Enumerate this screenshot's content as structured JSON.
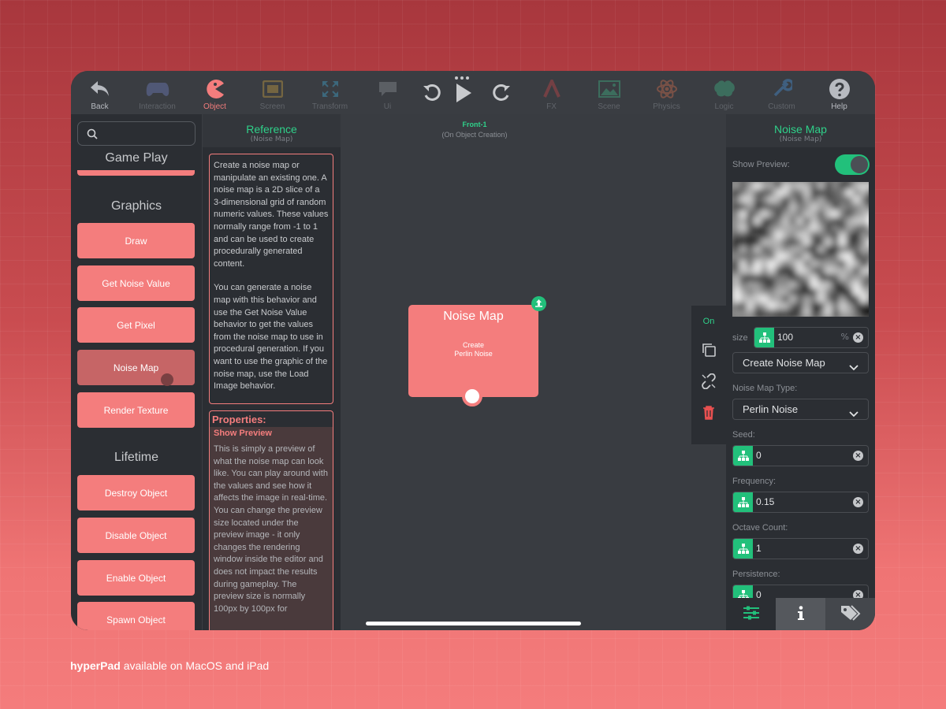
{
  "toolbar": {
    "items": [
      {
        "label": "Back",
        "icon": "back-arrow-icon",
        "state": "white"
      },
      {
        "label": "Interaction",
        "icon": "gamepad-icon",
        "state": "dim"
      },
      {
        "label": "Object",
        "icon": "pacman-icon",
        "state": "active"
      },
      {
        "label": "Screen",
        "icon": "screen-icon",
        "state": "dim"
      },
      {
        "label": "Transform",
        "icon": "expand-arrows-icon",
        "state": "dim"
      },
      {
        "label": "Ui",
        "icon": "chat-bubble-icon",
        "state": "dim"
      },
      {
        "label": "FX",
        "icon": "fx-icon",
        "state": "dim"
      },
      {
        "label": "Scene",
        "icon": "landscape-image-icon",
        "state": "dim"
      },
      {
        "label": "Physics",
        "icon": "atom-icon",
        "state": "dim"
      },
      {
        "label": "Logic",
        "icon": "brain-icon",
        "state": "dim"
      },
      {
        "label": "Custom",
        "icon": "wrench-icon",
        "state": "dim"
      },
      {
        "label": "Help",
        "icon": "question-icon",
        "state": "white"
      }
    ]
  },
  "sidebar": {
    "search_placeholder": "",
    "sections": {
      "game_play": "Game Play",
      "graphics": "Graphics",
      "lifetime": "Lifetime"
    },
    "graphics_items": [
      "Draw",
      "Get Noise Value",
      "Get Pixel",
      "Noise Map",
      "Render Texture"
    ],
    "lifetime_items": [
      "Destroy Object",
      "Disable Object",
      "Enable Object",
      "Spawn Object"
    ],
    "selected": "Noise Map"
  },
  "reference": {
    "title": "Reference",
    "subtitle": "(Noise Map)",
    "description_1": "Create a noise map or manipulate an existing one. A noise map is a 2D slice of a 3-dimensional grid of random numeric values. These values normally range from -1 to 1 and can be used to create procedurally generated content.",
    "description_2": "You can generate a noise map with this behavior and use the Get Noise Value behavior to get the values from the noise map to use in procedural generation. If you want to use the graphic of the noise map, use the Load Image behavior.",
    "properties_title": "Properties:",
    "prop_name": "Show Preview",
    "prop_desc": "This is simply a preview of what the noise map can look like. You can play around with the values and see how it affects the image in real-time. You can change the preview size located under the preview image - it only changes the rendering window inside the editor and does not impact the results during gameplay. The preview size is normally 100px by 100px for"
  },
  "canvas": {
    "scene_title": "Front-1",
    "scene_subtitle": "(On Object Creation)",
    "node_title": "Noise Map",
    "node_desc_1": "Create",
    "node_desc_2": "Perlin Noise",
    "tools_on": "On"
  },
  "settings": {
    "title": "Noise Map",
    "subtitle": "(Noise Map)",
    "show_preview_label": "Show Preview:",
    "show_preview": true,
    "size_label": "size",
    "size_value": "100",
    "size_unit": "%",
    "mode_value": "Create Noise Map",
    "type_label": "Noise Map Type:",
    "type_value": "Perlin Noise",
    "seed_label": "Seed:",
    "seed_value": "0",
    "frequency_label": "Frequency:",
    "frequency_value": "0.15",
    "octave_label": "Octave Count:",
    "octave_value": "1",
    "persistence_label": "Persistence:",
    "persistence_value": "0"
  },
  "colors": {
    "accent": "#f47d7d",
    "green": "#22c07b",
    "panel": "#2b2e33"
  },
  "caption": {
    "brand": "hyperPad",
    "text": " available on MacOS and iPad"
  }
}
